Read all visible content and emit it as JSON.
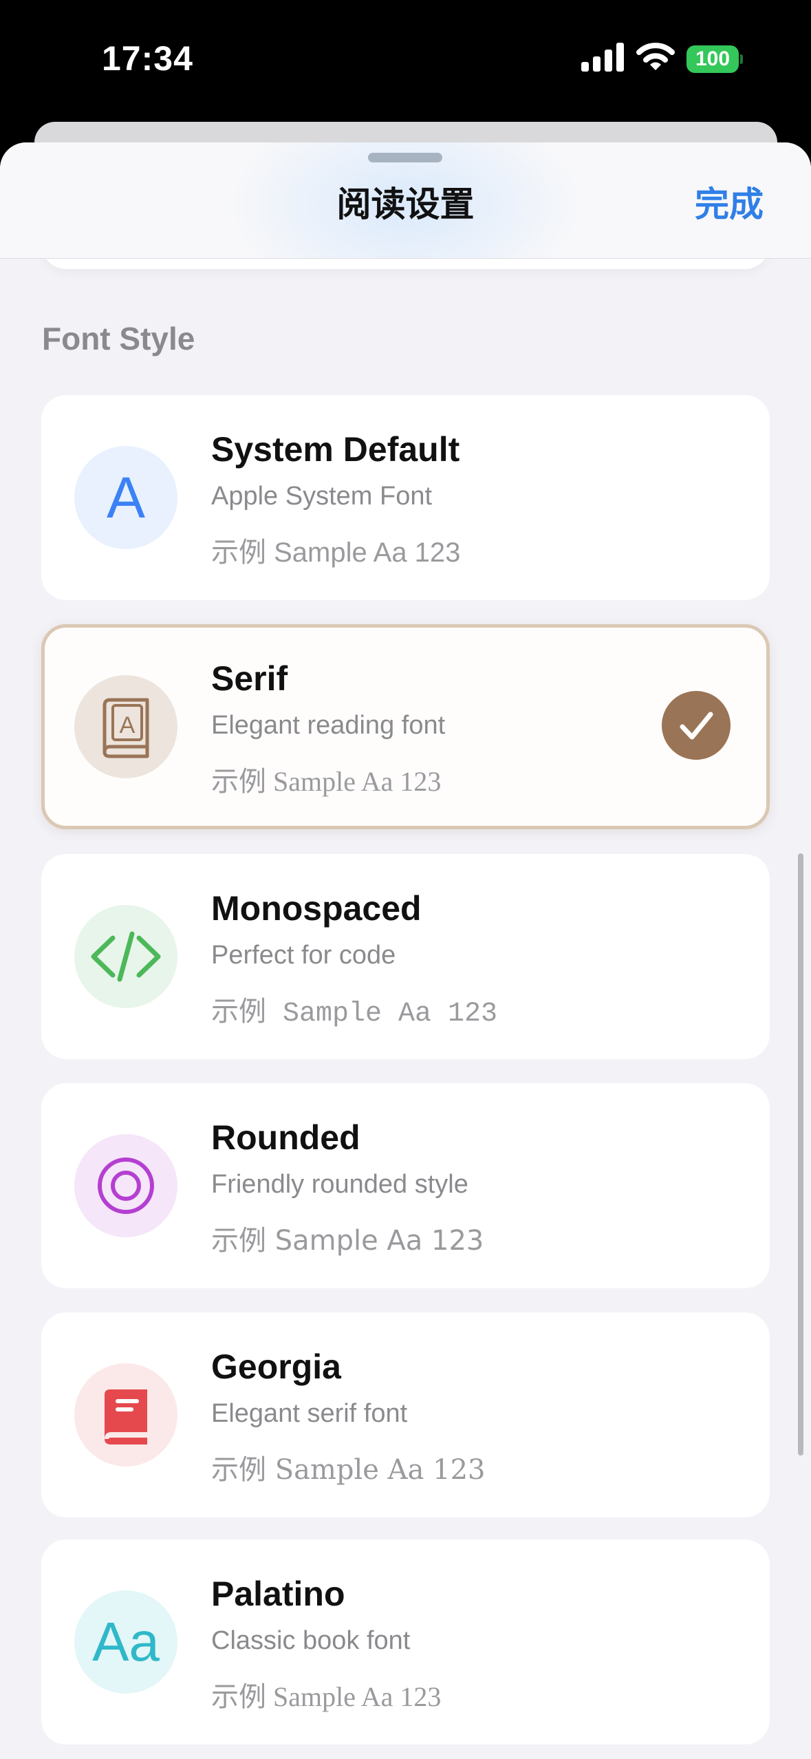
{
  "status_bar": {
    "time": "17:34",
    "battery": "100",
    "battery_color": "#34c759"
  },
  "sheet": {
    "title": "阅读设置",
    "done_label": "完成",
    "accent_color": "#2f7fe6"
  },
  "font_style": {
    "section_title": "Font Style",
    "selected": "Serif",
    "options": [
      {
        "title": "System Default",
        "subtitle": "Apple System Font",
        "sample": "示例 Sample Aa 123",
        "icon": "letter-a-icon",
        "icon_glyph": "A",
        "icon_color": "#3b82f6",
        "icon_bg": "#e8f1fd"
      },
      {
        "title": "Serif",
        "subtitle": "Elegant reading font",
        "sample": "示例 Sample Aa 123",
        "icon": "book-icon",
        "icon_color": "#9a7456",
        "icon_bg": "#ece4dd",
        "selected": true
      },
      {
        "title": "Monospaced",
        "subtitle": "Perfect for code",
        "sample": "示例 Sample Aa 123",
        "icon": "code-brackets-icon",
        "icon_color": "#4cb85a",
        "icon_bg": "#e8f5ea"
      },
      {
        "title": "Rounded",
        "subtitle": "Friendly rounded style",
        "sample": "示例 Sample Aa 123",
        "icon": "concentric-circle-icon",
        "icon_color": "#b43fd1",
        "icon_bg": "#f5e6f9"
      },
      {
        "title": "Georgia",
        "subtitle": "Elegant serif font",
        "sample": "示例 Sample Aa 123",
        "icon": "book-closed-icon",
        "icon_color": "#e5484d",
        "icon_bg": "#fbe9e9"
      },
      {
        "title": "Palatino",
        "subtitle": "Classic book font",
        "sample": "示例 Sample Aa 123",
        "icon": "letters-aa-icon",
        "icon_glyph": "Aa",
        "icon_color": "#2fb8c9",
        "icon_bg": "#e3f6f8"
      }
    ]
  }
}
